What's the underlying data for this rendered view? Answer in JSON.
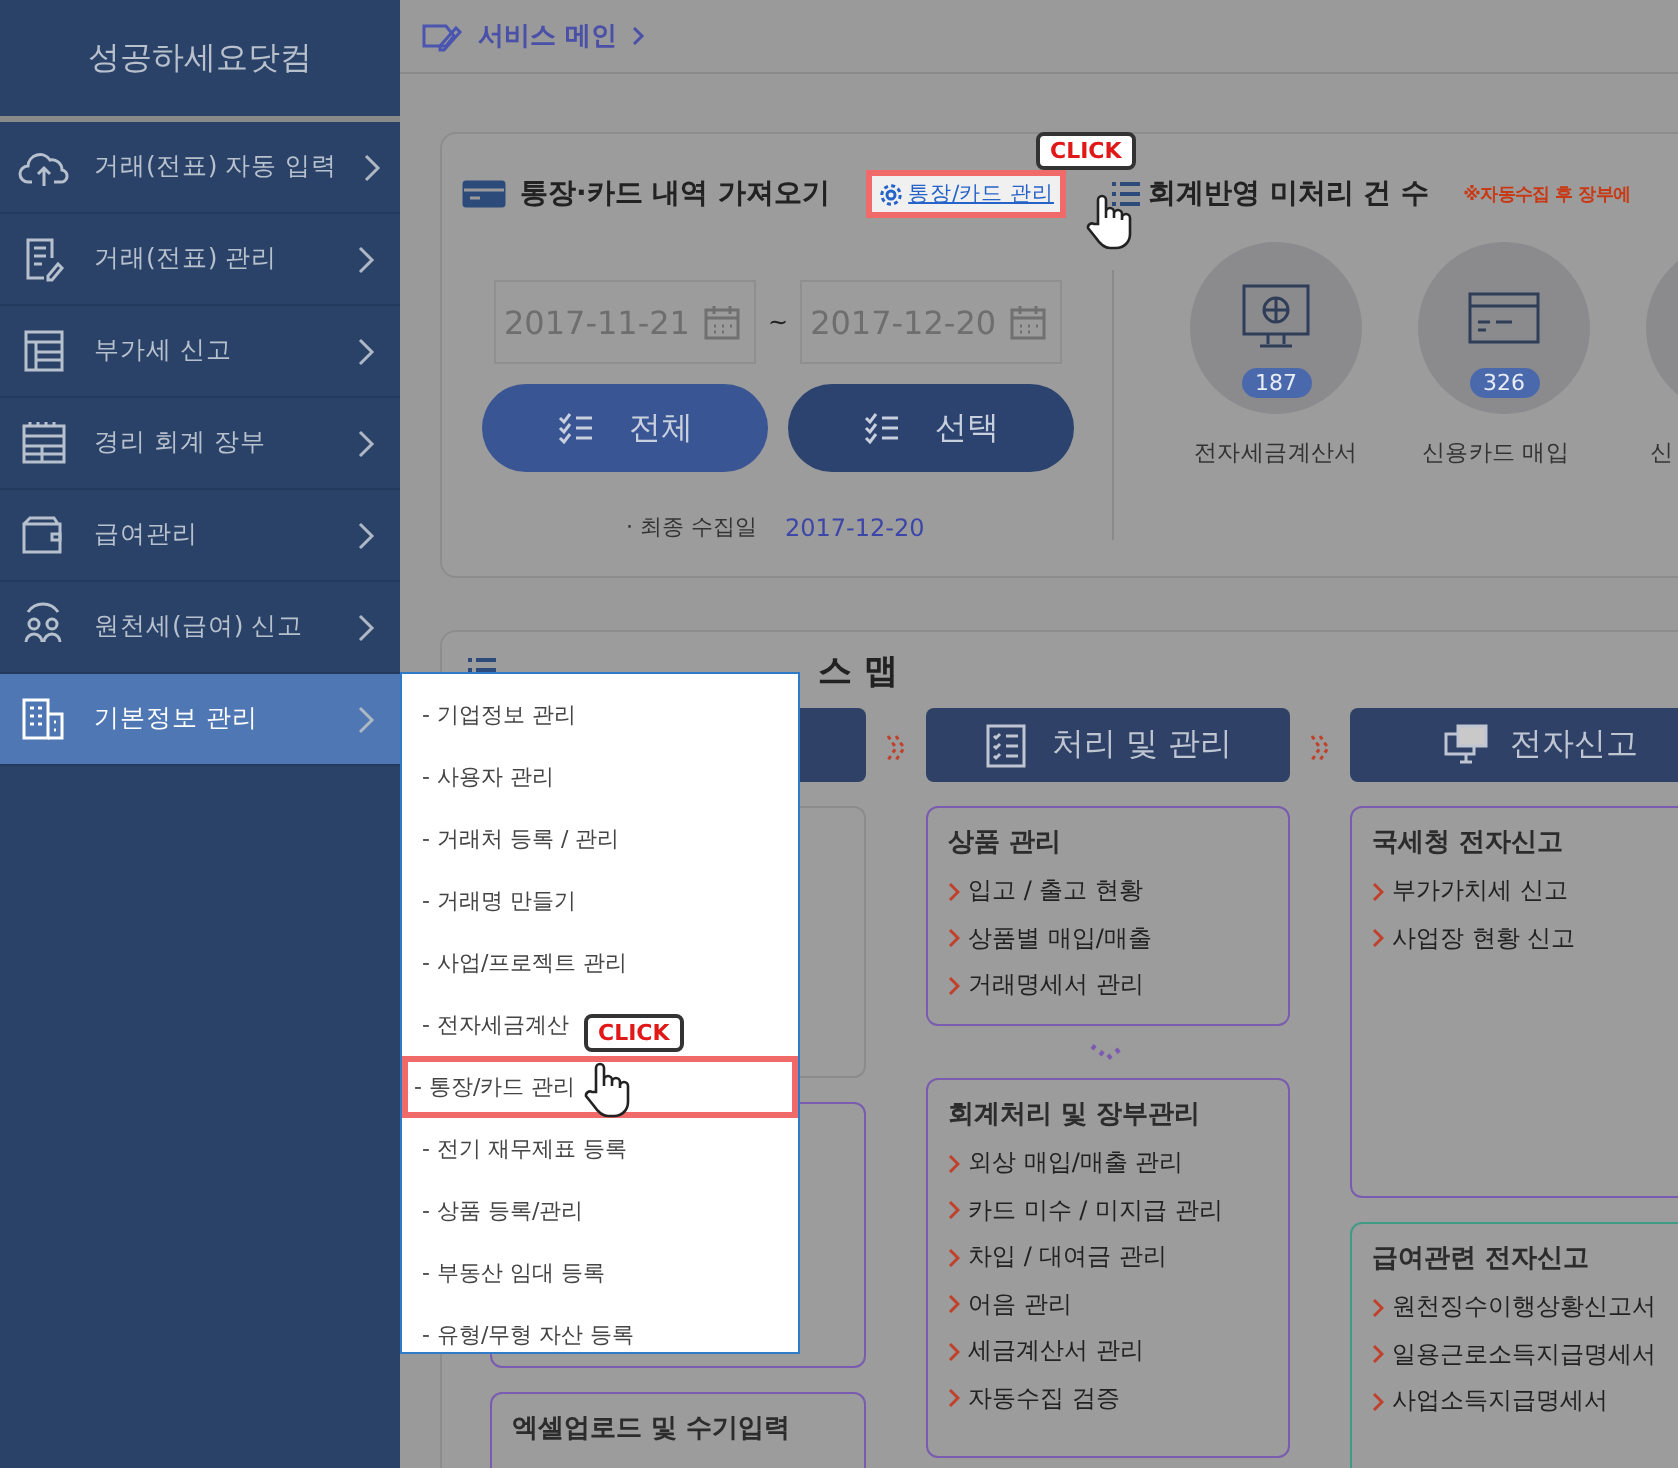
{
  "sidebar": {
    "title": "성공하세요닷컴",
    "items": [
      {
        "label": "거래(전표) 자동 입력",
        "selected": false
      },
      {
        "label": "거래(전표) 관리",
        "selected": false
      },
      {
        "label": "부가세 신고",
        "selected": false
      },
      {
        "label": "경리 회계 장부",
        "selected": false
      },
      {
        "label": "급여관리",
        "selected": false
      },
      {
        "label": "원천세(급여) 신고",
        "selected": false
      },
      {
        "label": "기본정보 관리",
        "selected": true
      }
    ]
  },
  "breadcrumb": {
    "label": "서비스 메인"
  },
  "import_panel": {
    "title": "통장·카드 내역 가져오기",
    "manage_link": {
      "label": "통장/카드 관리",
      "highlighted": true,
      "hint": "CLICK"
    },
    "date_from": "2017-11-21",
    "separator": "~",
    "date_to": "2017-12-20",
    "buttons": [
      {
        "label": "전체",
        "selected": false
      },
      {
        "label": "선택",
        "selected": true
      }
    ],
    "last_collected_label": "· 최종 수집일",
    "last_collected_date": "2017-12-20"
  },
  "pending_panel": {
    "title": "회계반영 미처리 건 수",
    "note": "※자동수집 후 장부에",
    "items": [
      {
        "count": "187",
        "label": "전자세금계산서"
      },
      {
        "count": "326",
        "label": "신용카드 매입"
      },
      {
        "label": "신"
      }
    ]
  },
  "process_map": {
    "title": "스 맵",
    "columns": [
      {
        "boxes": [
          {
            "color": "#8c8c8c"
          },
          {
            "color": "#7a5bb0"
          },
          {
            "color": "#7a5bb0",
            "title": "엑셀업로드 및 수기입력"
          }
        ]
      },
      {
        "header": "처리 및 관리",
        "boxes": [
          {
            "color": "#7a5bb0",
            "title": "상품 관리",
            "items": [
              "입고 / 출고 현황",
              "상품별 매입/매출",
              "거래명세서 관리"
            ]
          },
          {
            "color": "#7a5bb0",
            "title": "회계처리 및 장부관리",
            "items": [
              "외상 매입/매출 관리",
              "카드 미수 / 미지급 관리",
              "차입 / 대여금 관리",
              "어음 관리",
              "세금계산서 관리",
              "자동수집 검증"
            ]
          }
        ]
      },
      {
        "header": "전자신고",
        "boxes": [
          {
            "color": "#7a5bb0",
            "title": "국세청 전자신고",
            "items": [
              "부가가치세 신고",
              "사업장 현황 신고"
            ]
          },
          {
            "color": "#3f9a86",
            "title": "급여관련 전자신고",
            "items": [
              "원천징수이행상황신고서",
              "일용근로소득지급명세서",
              "사업소득지급명세서"
            ]
          }
        ]
      }
    ]
  },
  "dropdown": {
    "hint": "CLICK",
    "items": [
      {
        "label": "- 기업정보 관리",
        "selected": false
      },
      {
        "label": "- 사용자 관리",
        "selected": false
      },
      {
        "label": "- 거래처 등록 / 관리",
        "selected": false
      },
      {
        "label": "- 거래명 만들기",
        "selected": false
      },
      {
        "label": "- 사업/프로젝트 관리",
        "selected": false
      },
      {
        "label": "- 전자세금계산",
        "selected": false
      },
      {
        "label": "- 통장/카드 관리",
        "selected": true
      },
      {
        "label": "- 전기 재무제표 등록",
        "selected": false
      },
      {
        "label": "- 상품 등록/관리",
        "selected": false
      },
      {
        "label": "- 부동산 임대 등록",
        "selected": false
      },
      {
        "label": "- 유형/무형 자산 등록",
        "selected": false
      }
    ]
  }
}
